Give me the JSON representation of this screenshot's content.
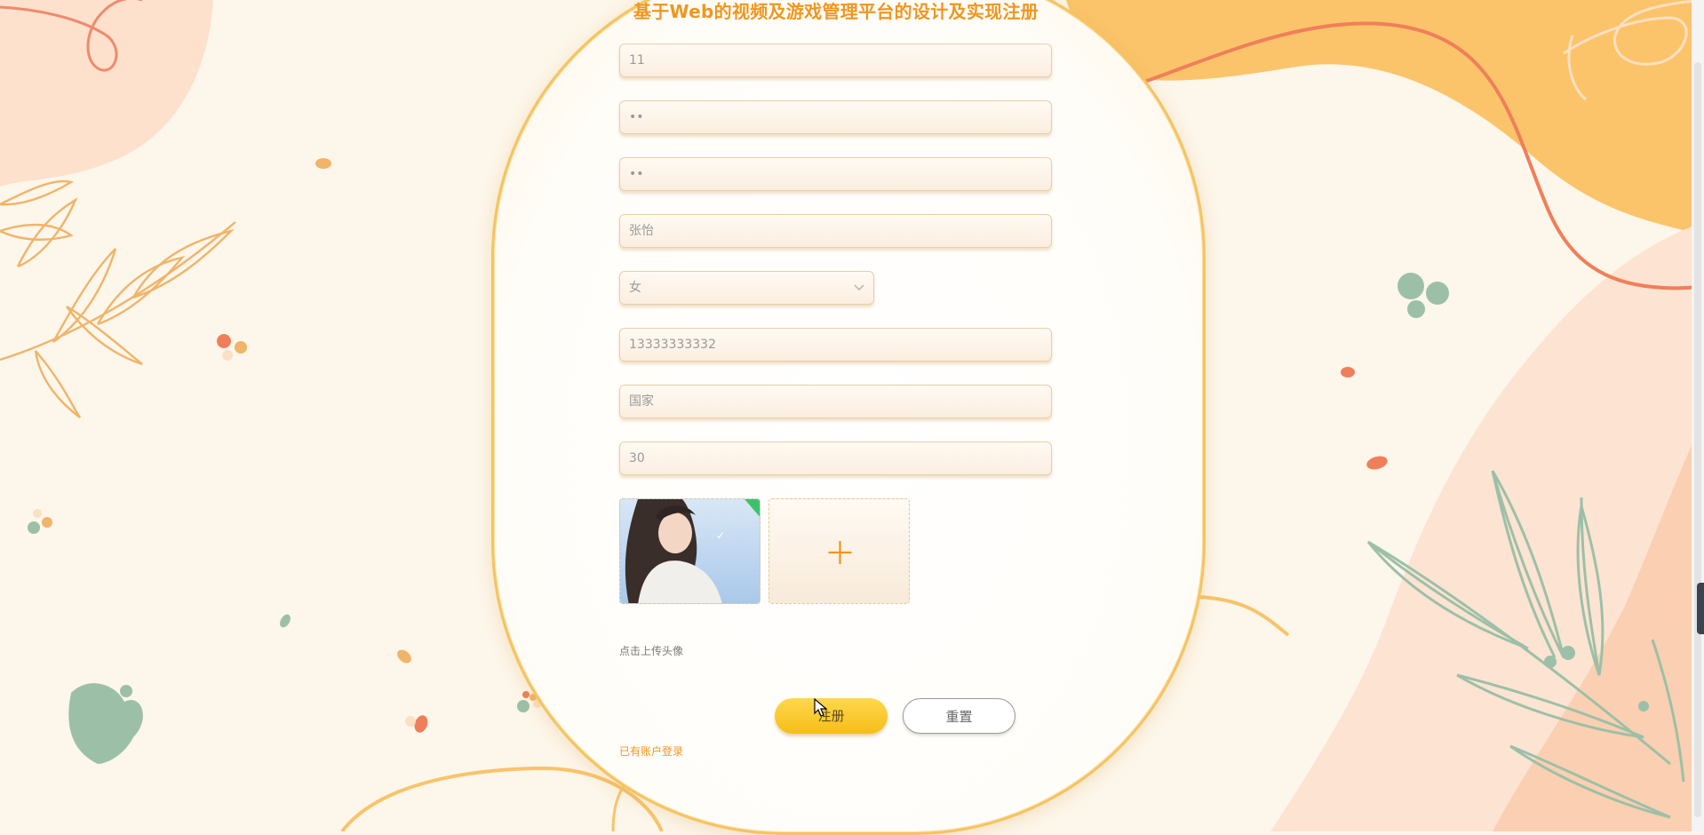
{
  "header": {
    "title": "基于Web的视频及游戏管理平台的设计及实现注册"
  },
  "form": {
    "fields": [
      {
        "value": "11"
      },
      {
        "value": "••"
      },
      {
        "value": "••"
      },
      {
        "value": "张怡"
      },
      {
        "value": "女"
      },
      {
        "value": "13333333332"
      },
      {
        "value": "国家"
      },
      {
        "value": "30"
      }
    ],
    "upload_hint": "点击上传头像",
    "add_icon": "plus-icon",
    "uploaded_icon": "check-icon"
  },
  "actions": {
    "register_label": "注册",
    "reset_label": "重置",
    "login_link": "已有账户登录"
  },
  "colors": {
    "accent": "#f0961e",
    "button_yellow": "#f6bd18",
    "field_border": "#e8cfa5",
    "leaf_orange": "#f0b46a",
    "leaf_green": "#9cc0a7"
  }
}
